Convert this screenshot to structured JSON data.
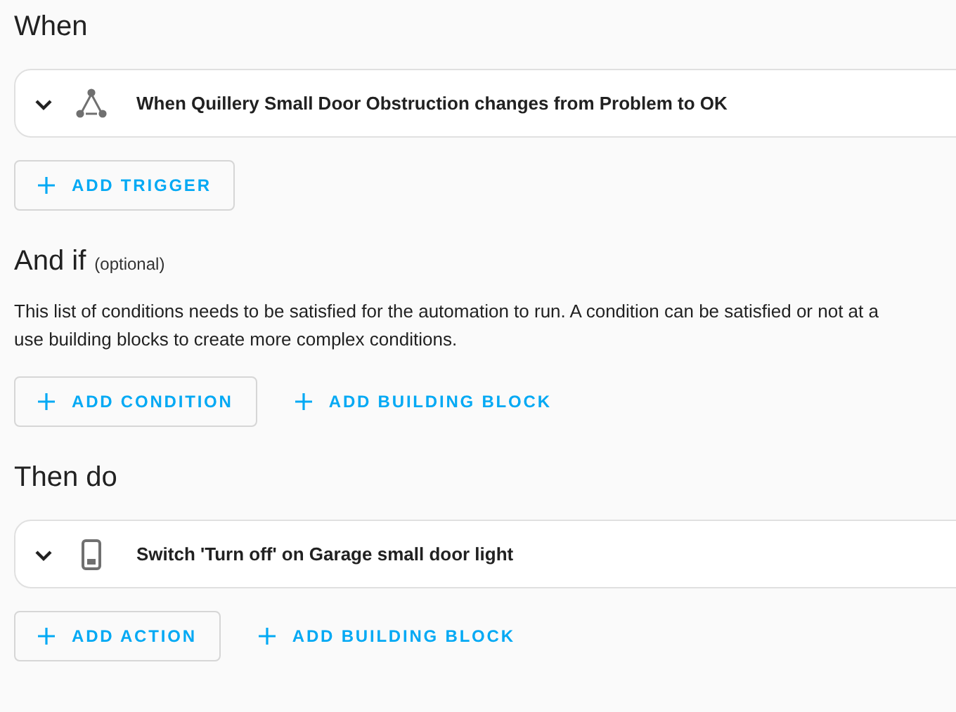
{
  "sections": [
    {
      "heading": "When",
      "items": [
        {
          "kind": "state",
          "label": "When Quillery Small Door Obstruction changes from Problem to OK",
          "expanded": false
        }
      ],
      "buttons": [
        {
          "label": "ADD TRIGGER",
          "kind": "outlined"
        }
      ]
    },
    {
      "heading": "And if",
      "note": "(optional)",
      "description": [
        "This list of conditions needs to be satisfied for the automation to run. A condition can be satisfied or not at a",
        "use building blocks to create more complex conditions."
      ],
      "buttons": [
        {
          "label": "ADD CONDITION",
          "kind": "outlined"
        },
        {
          "label": "ADD BUILDING BLOCK",
          "kind": "text"
        }
      ]
    },
    {
      "heading": "Then do",
      "items": [
        {
          "kind": "device",
          "label": "Switch 'Turn off' on Garage small door light",
          "expanded": false
        }
      ],
      "buttons": [
        {
          "label": "ADD ACTION",
          "kind": "outlined"
        },
        {
          "label": "ADD BUILDING BLOCK",
          "kind": "text"
        }
      ]
    }
  ]
}
